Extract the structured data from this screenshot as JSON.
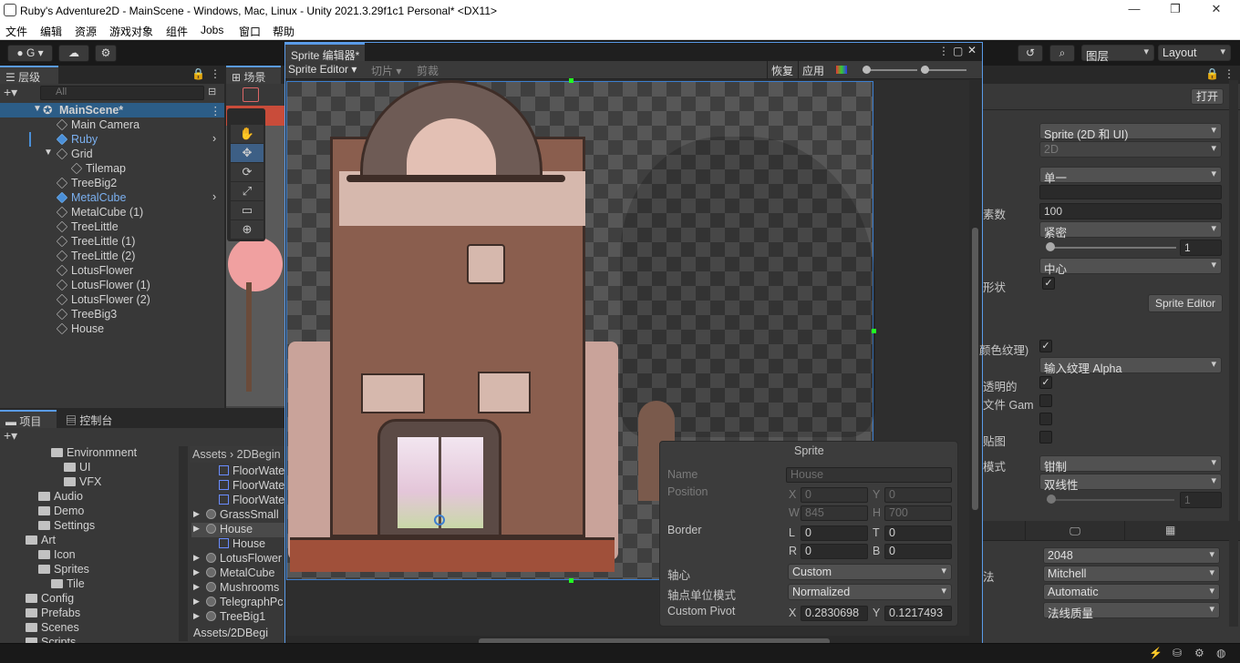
{
  "window": {
    "title": "Ruby's Adventure2D - MainScene - Windows, Mac, Linux - Unity 2021.3.29f1c1 Personal* <DX11>",
    "minimize": "—",
    "maximize": "❐",
    "close": "✕"
  },
  "menu": [
    "文件",
    "编辑",
    "资源",
    "游戏对象",
    "组件",
    "Jobs",
    "窗口",
    "帮助"
  ],
  "toolbar": {
    "account_label": "G",
    "layers_label": "图层",
    "layout_label": "Layout"
  },
  "hierarchy": {
    "tab": "层级",
    "search_placeholder": "All",
    "scene": "MainScene*",
    "items": [
      {
        "label": "Main Camera",
        "indent": 1,
        "highlight": false,
        "arrow": false
      },
      {
        "label": "Ruby",
        "indent": 1,
        "highlight": true,
        "arrow": true
      },
      {
        "label": "Grid",
        "indent": 1,
        "highlight": false,
        "arrow": false
      },
      {
        "label": "Tilemap",
        "indent": 2,
        "highlight": false,
        "arrow": false
      },
      {
        "label": "TreeBig2",
        "indent": 1,
        "highlight": false,
        "arrow": false
      },
      {
        "label": "MetalCube",
        "indent": 1,
        "highlight": true,
        "arrow": true
      },
      {
        "label": "MetalCube (1)",
        "indent": 1,
        "highlight": false,
        "arrow": false
      },
      {
        "label": "TreeLittle",
        "indent": 1,
        "highlight": false,
        "arrow": false
      },
      {
        "label": "TreeLittle (1)",
        "indent": 1,
        "highlight": false,
        "arrow": false
      },
      {
        "label": "TreeLittle (2)",
        "indent": 1,
        "highlight": false,
        "arrow": false
      },
      {
        "label": "LotusFlower",
        "indent": 1,
        "highlight": false,
        "arrow": false
      },
      {
        "label": "LotusFlower (1)",
        "indent": 1,
        "highlight": false,
        "arrow": false
      },
      {
        "label": "LotusFlower (2)",
        "indent": 1,
        "highlight": false,
        "arrow": false
      },
      {
        "label": "TreeBig3",
        "indent": 1,
        "highlight": false,
        "arrow": false
      },
      {
        "label": "House",
        "indent": 1,
        "highlight": false,
        "arrow": false
      }
    ]
  },
  "scene": {
    "tab": "场景"
  },
  "project": {
    "tab_project": "项目",
    "tab_console": "控制台",
    "folders": [
      {
        "label": "Environmnent",
        "indent": 3
      },
      {
        "label": "UI",
        "indent": 4
      },
      {
        "label": "VFX",
        "indent": 4
      },
      {
        "label": "Audio",
        "indent": 2
      },
      {
        "label": "Demo",
        "indent": 2
      },
      {
        "label": "Settings",
        "indent": 2
      },
      {
        "label": "Art",
        "indent": 1
      },
      {
        "label": "Icon",
        "indent": 2
      },
      {
        "label": "Sprites",
        "indent": 2
      },
      {
        "label": "Tile",
        "indent": 3
      },
      {
        "label": "Config",
        "indent": 1
      },
      {
        "label": "Prefabs",
        "indent": 1
      },
      {
        "label": "Scenes",
        "indent": 1
      },
      {
        "label": "Scripts",
        "indent": 1
      }
    ],
    "breadcrumb": [
      "Assets",
      "2DBegin"
    ],
    "assets": [
      {
        "label": "FloorWate",
        "sub": true
      },
      {
        "label": "FloorWate",
        "sub": true
      },
      {
        "label": "FloorWate",
        "sub": true
      },
      {
        "label": "GrassSmall",
        "sub": false
      },
      {
        "label": "House",
        "sub": false
      },
      {
        "label": "House",
        "sub": true
      },
      {
        "label": "LotusFlower",
        "sub": false
      },
      {
        "label": "MetalCube",
        "sub": false
      },
      {
        "label": "Mushrooms",
        "sub": false
      },
      {
        "label": "TelegraphPc",
        "sub": false
      },
      {
        "label": "TreeBig1",
        "sub": false
      }
    ],
    "footer_path": "Assets/2DBegi"
  },
  "sprite_editor": {
    "tab": "Sprite 编辑器*",
    "mode": "Sprite Editor",
    "slice": "切片",
    "trim": "剪裁",
    "revert": "恢复",
    "apply": "应用"
  },
  "sprite_panel": {
    "header": "Sprite",
    "name_label": "Name",
    "name_value": "House",
    "position_label": "Position",
    "x_label": "X",
    "x_value": "0",
    "y_label": "Y",
    "y_value": "0",
    "w_label": "W",
    "w_value": "845",
    "h_label": "H",
    "h_value": "700",
    "border_label": "Border",
    "l_label": "L",
    "l_value": "0",
    "t_label": "T",
    "t_value": "0",
    "r_label": "R",
    "r_value": "0",
    "b_label": "B",
    "b_value": "0",
    "pivot_label": "轴心",
    "pivot_value": "Custom",
    "pivot_unit_label": "轴点单位模式",
    "pivot_unit_value": "Normalized",
    "custom_pivot_label": "Custom Pivot",
    "cp_x_label": "X",
    "cp_x_value": "0.2830698",
    "cp_y_label": "Y",
    "cp_y_value": "0.1217493"
  },
  "inspector": {
    "open_button": "打开",
    "texture_type": "Sprite (2D 和 UI)",
    "texture_shape": "2D",
    "sprite_mode": "单一",
    "ppu_label": "素数",
    "ppu_value": "100",
    "mesh_label": "紧密",
    "extrude_value": "1",
    "pivot_value": "中心",
    "shape_label": "形状",
    "sprite_editor_button": "Sprite Editor",
    "srgb_label": "颜色纹理)",
    "alpha_source": "输入纹理 Alpha",
    "alpha_transparent_label": "透明的",
    "gamma_label": "文件 Gam",
    "fx_label": "贴图",
    "mode_label": "模式",
    "wrap_mode": "钳制",
    "filter_mode": "双线性",
    "aniso_value": "1",
    "max_size": "2048",
    "resize_algo_label": "法",
    "resize_algo": "Mitchell",
    "format": "Automatic",
    "compression": "法线质量"
  }
}
